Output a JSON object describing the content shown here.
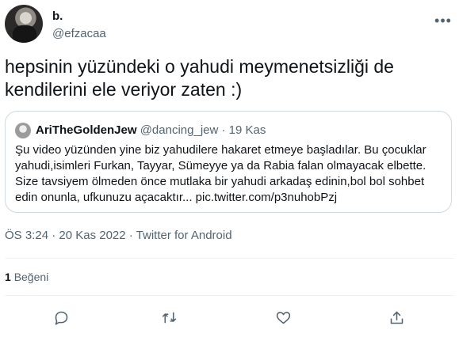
{
  "author": {
    "name": "b.",
    "handle": "@efzacaa"
  },
  "tweet": {
    "text": "hepsinin yüzündeki o yahudi meymenetsizliği de kendilerini ele veriyor zaten :)"
  },
  "quote": {
    "name": "AriTheGoldenJew",
    "handle": "@dancing_jew",
    "separator": " · ",
    "date": "19 Kas",
    "text": "Şu video yüzünden yine biz yahudilere hakaret etmeye başladılar. Bu çocuklar yahudi,isimleri Furkan, Tayyar, Sümeyye ya da Rabia falan olmayacak elbette. Size tavsiyem ölmeden önce mutlaka bir yahudi arkadaş edinin,bol bol sohbet edin onunla, ufkunuzu açacaktır... pic.twitter.com/p3nuhobPzj"
  },
  "meta": {
    "time_date": "ÖS 3:24 · 20 Kas 2022",
    "separator": " · ",
    "source": "Twitter for Android"
  },
  "likes": {
    "count": "1",
    "label": "Beğeni"
  },
  "icons": {
    "more": "more-horizontal-icon",
    "reply": "reply-icon",
    "retweet": "retweet-icon",
    "like": "heart-icon",
    "share": "share-icon"
  },
  "colors": {
    "text": "#0f1419",
    "secondary": "#536471",
    "border": "#cfd9de",
    "divider": "#eff3f4"
  }
}
